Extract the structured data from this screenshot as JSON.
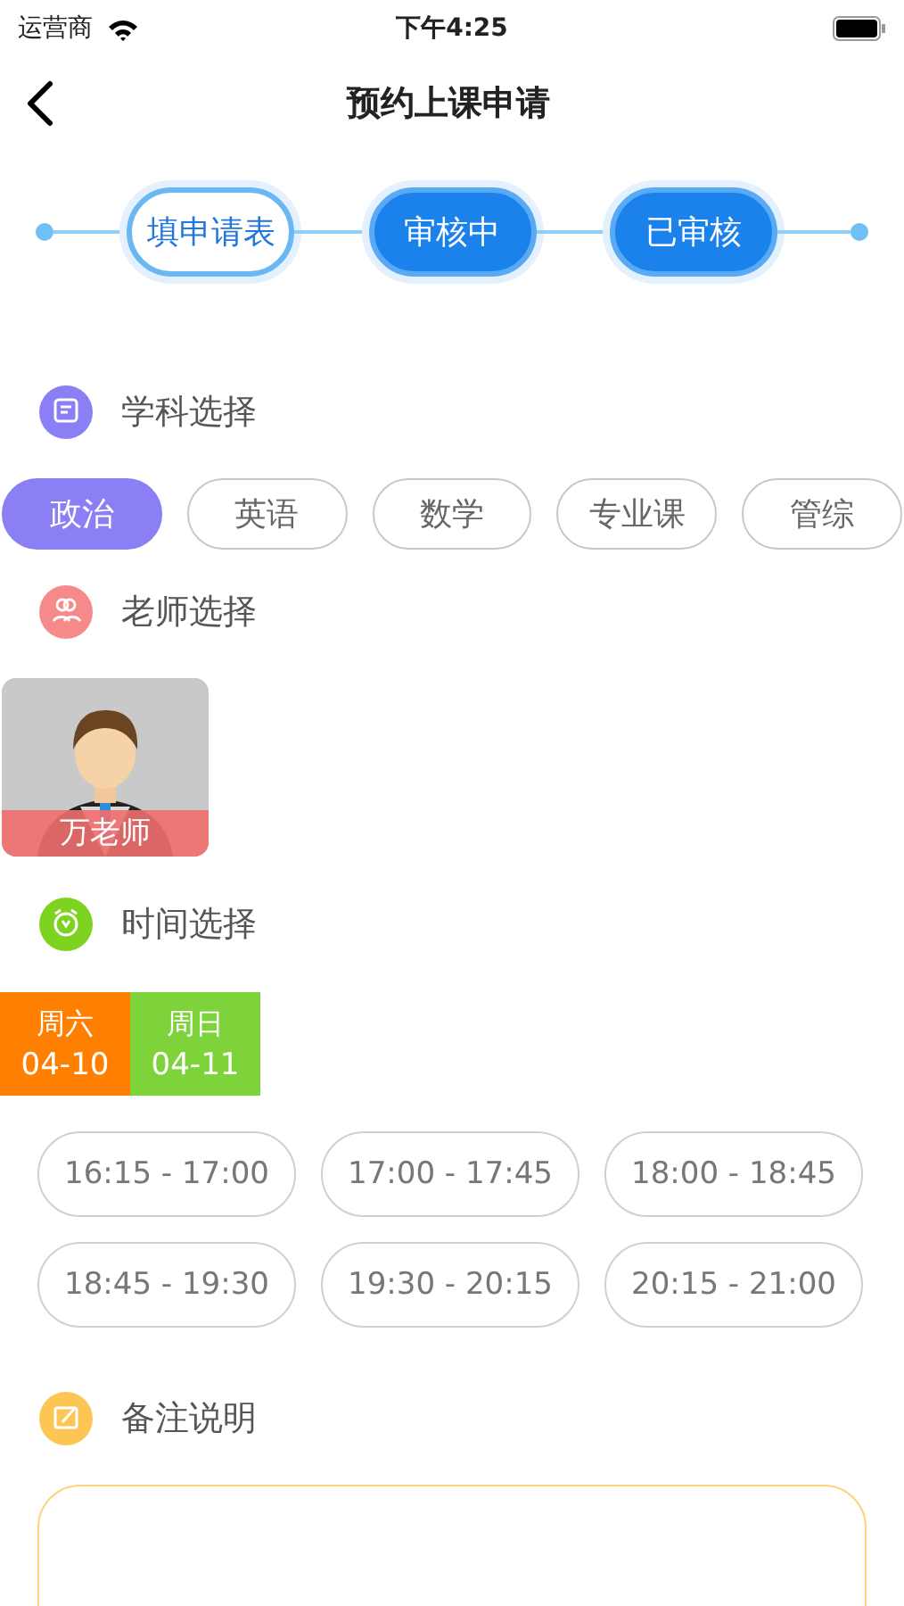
{
  "status_bar": {
    "carrier": "运营商",
    "time": "下午4:25"
  },
  "nav": {
    "title": "预约上课申请"
  },
  "steps": [
    {
      "label": "填申请表",
      "selected": true
    },
    {
      "label": "审核中",
      "selected": false
    },
    {
      "label": "已审核",
      "selected": false
    }
  ],
  "subject_section": {
    "title": "学科选择",
    "color": "#8b7ff5",
    "subjects": [
      {
        "label": "政治",
        "selected": true
      },
      {
        "label": "英语",
        "selected": false
      },
      {
        "label": "数学",
        "selected": false
      },
      {
        "label": "专业课",
        "selected": false
      },
      {
        "label": "管综",
        "selected": false
      }
    ]
  },
  "teacher_section": {
    "title": "老师选择",
    "color": "#f68a8a",
    "teachers": [
      {
        "name": "万老师",
        "kind": "picture"
      }
    ]
  },
  "time_section": {
    "title": "时间选择",
    "color": "#7ed321",
    "days": [
      {
        "weekday": "周六",
        "date": "04-10",
        "color": "#ff8000"
      },
      {
        "weekday": "周日",
        "date": "04-11",
        "color": "#7ed33a"
      }
    ],
    "slots": [
      "16:15 - 17:00",
      "17:00 - 17:45",
      "18:00 - 18:45",
      "18:45 - 19:30",
      "19:30 - 20:15",
      "20:15 - 21:00"
    ]
  },
  "note_section": {
    "title": "备注说明",
    "color": "#fdc553"
  }
}
